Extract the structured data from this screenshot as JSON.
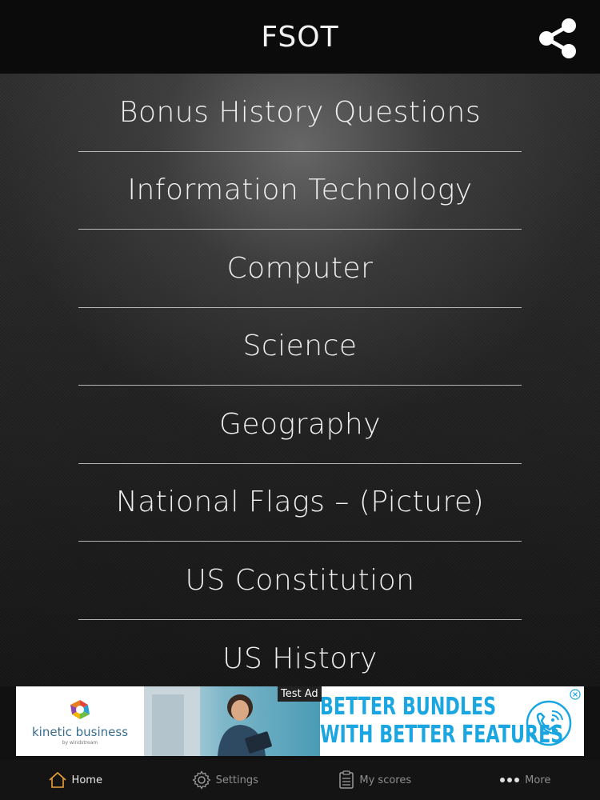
{
  "header": {
    "title": "FSOT",
    "share_icon": "share-icon"
  },
  "menu": {
    "items": [
      {
        "label": "Bonus History Questions"
      },
      {
        "label": "Information Technology"
      },
      {
        "label": "Computer"
      },
      {
        "label": "Science"
      },
      {
        "label": "Geography"
      },
      {
        "label": "National Flags – (Picture)"
      },
      {
        "label": "US Constitution"
      },
      {
        "label": "US History"
      }
    ]
  },
  "ad": {
    "label": "Test Ad",
    "brand": "kinetic business",
    "brand_sub": "by windstream",
    "headline_line1": "BETTER BUNDLES",
    "headline_line2": "WITH BETTER FEATURES",
    "headline_color": "#1aa6e0"
  },
  "tabbar": {
    "active_color": "#e8a13a",
    "tabs": [
      {
        "label": "Home",
        "icon": "home-icon",
        "active": true
      },
      {
        "label": "Settings",
        "icon": "gear-icon",
        "active": false
      },
      {
        "label": "My scores",
        "icon": "clipboard-icon",
        "active": false
      },
      {
        "label": "More",
        "icon": "more-dots-icon",
        "active": false
      }
    ]
  }
}
